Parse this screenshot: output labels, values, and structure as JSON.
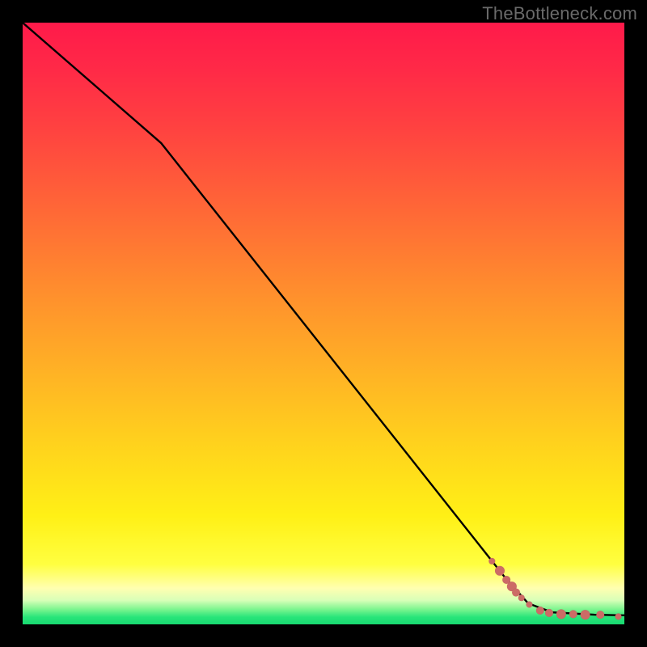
{
  "attribution": "TheBottleneck.com",
  "colors": {
    "page_bg": "#000000",
    "text": "#6a6a6a",
    "dot": "#cc6b66",
    "line": "#000000"
  },
  "chart_data": {
    "type": "line",
    "title": "",
    "xlabel": "",
    "ylabel": "",
    "xlim": [
      0,
      100
    ],
    "ylim": [
      0,
      100
    ],
    "grid": false,
    "curve": [
      {
        "x": 0,
        "y": 100
      },
      {
        "x": 23,
        "y": 80
      },
      {
        "x": 80,
        "y": 8
      },
      {
        "x": 84,
        "y": 3.5
      },
      {
        "x": 88,
        "y": 2.0
      },
      {
        "x": 95,
        "y": 1.6
      },
      {
        "x": 100,
        "y": 1.5
      }
    ],
    "scatter": [
      {
        "x": 78.0,
        "y": 10.5,
        "r": 4
      },
      {
        "x": 79.3,
        "y": 8.9,
        "r": 6
      },
      {
        "x": 80.4,
        "y": 7.4,
        "r": 5
      },
      {
        "x": 81.3,
        "y": 6.3,
        "r": 6
      },
      {
        "x": 82.0,
        "y": 5.3,
        "r": 5
      },
      {
        "x": 82.9,
        "y": 4.4,
        "r": 4
      },
      {
        "x": 84.2,
        "y": 3.3,
        "r": 4
      },
      {
        "x": 86.0,
        "y": 2.3,
        "r": 5
      },
      {
        "x": 87.5,
        "y": 1.9,
        "r": 5
      },
      {
        "x": 89.5,
        "y": 1.7,
        "r": 6
      },
      {
        "x": 91.5,
        "y": 1.7,
        "r": 5
      },
      {
        "x": 93.5,
        "y": 1.6,
        "r": 6
      },
      {
        "x": 96.0,
        "y": 1.6,
        "r": 5
      },
      {
        "x": 99.0,
        "y": 1.3,
        "r": 4
      }
    ]
  }
}
